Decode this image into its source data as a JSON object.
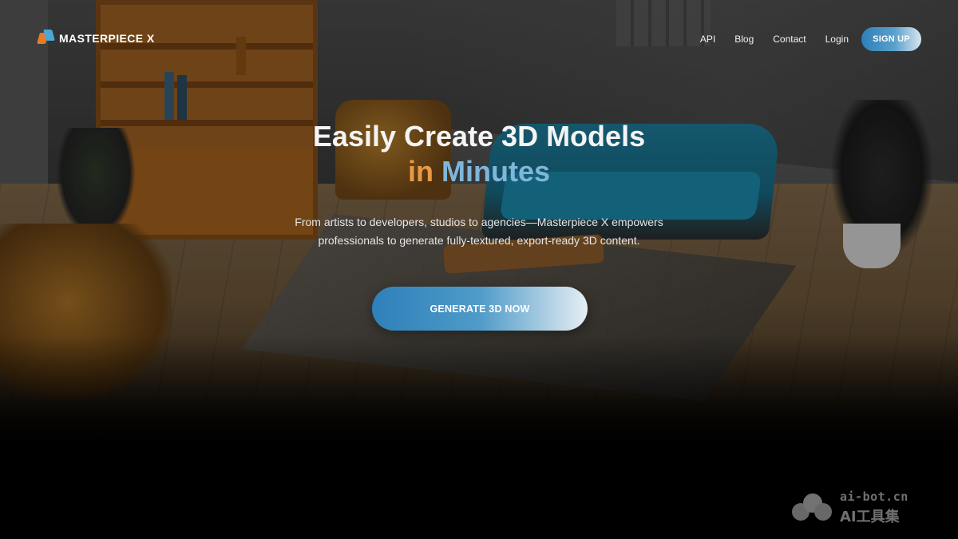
{
  "brand": {
    "name": "MASTERPIECE X",
    "logo_icon": "masterpiece-x-logo-icon",
    "colors": {
      "orange": "#e89a45",
      "blue": "#2e80b9",
      "light": "#e6eef3"
    }
  },
  "nav": {
    "items": [
      "API",
      "Blog",
      "Contact",
      "Login"
    ],
    "signup_label": "SIGN UP"
  },
  "hero": {
    "title": "Easily Create 3D Models",
    "subtitle_part1": "in",
    "subtitle_part2": "Minutes",
    "description": "From artists to developers, studios to agencies—Masterpiece X empowers professionals to generate fully-textured, export-ready 3D content.",
    "cta_label": "GENERATE 3D NOW"
  },
  "watermark": {
    "line1": "ai-bot.cn",
    "line2": "AI工具集"
  }
}
